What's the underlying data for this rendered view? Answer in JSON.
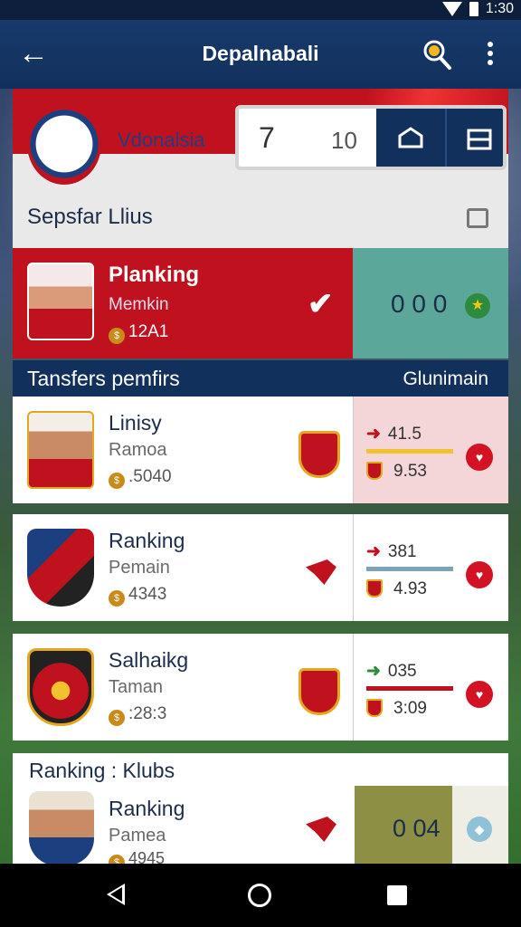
{
  "status": {
    "time": "1:30"
  },
  "appbar": {
    "title": "Depalnabali",
    "back_icon": "back-arrow-icon",
    "search_icon": "search-icon",
    "more_icon": "more-vert-icon"
  },
  "header": {
    "club_name": "Vdonalsia",
    "score_left": "7",
    "score_right": "10",
    "section_title": "Sepsfar Llius"
  },
  "featured": {
    "name": "Planking",
    "role": "Memkin",
    "value": "12A1",
    "score": "0 0 0"
  },
  "transfers": {
    "title": "Tansfers pemfirs",
    "right_label": "Glunimain"
  },
  "rows": [
    {
      "name": "Linisy",
      "role": "Ramoa",
      "value": ".5040",
      "stat1": "41.5",
      "stat2": "9.53",
      "bar_color": "#f2c12e"
    },
    {
      "name": "Ranking",
      "role": "Pemain",
      "value": "4343",
      "stat1": "381",
      "stat2": "4.93",
      "bar_color": "#7fa3b8"
    },
    {
      "name": "Salhaikg",
      "role": "Taman",
      "value": ":28:3",
      "stat1": "035",
      "stat2": "3:09",
      "bar_color": "#c0111f"
    }
  ],
  "ranking": {
    "heading": "Ranking : Klubs",
    "name": "Ranking",
    "role": "Pamea",
    "value": "4945",
    "score": "0 04"
  },
  "colors": {
    "primary_red": "#c0111f",
    "navy": "#12305c",
    "teal": "#5ba79a",
    "olive": "#8d8f45"
  }
}
